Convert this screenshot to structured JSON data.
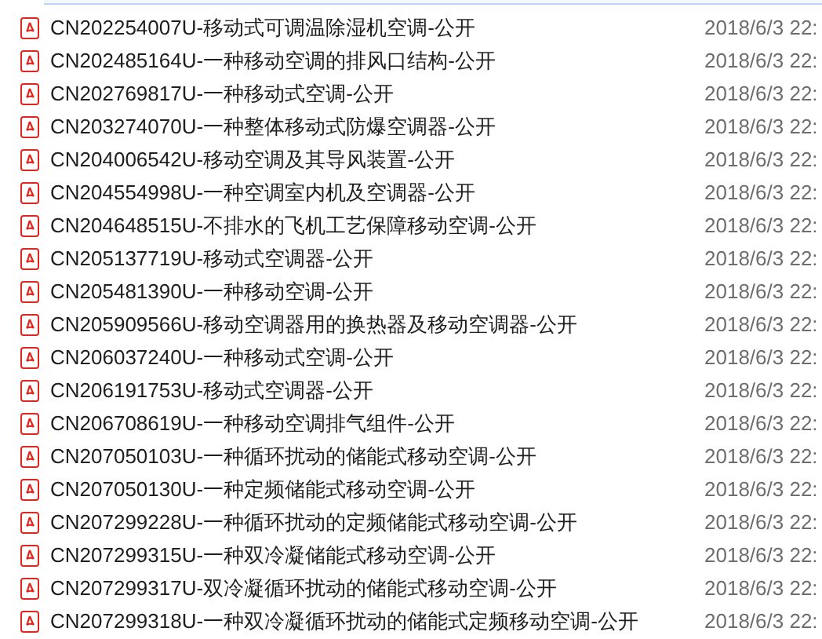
{
  "files": [
    {
      "name": "CN202254007U-移动式可调温除湿机空调-公开",
      "date": "2018/6/3 22:"
    },
    {
      "name": "CN202485164U-一种移动空调的排风口结构-公开",
      "date": "2018/6/3 22:"
    },
    {
      "name": "CN202769817U-一种移动式空调-公开",
      "date": "2018/6/3 22:"
    },
    {
      "name": "CN203274070U-一种整体移动式防爆空调器-公开",
      "date": "2018/6/3 22:"
    },
    {
      "name": "CN204006542U-移动空调及其导风装置-公开",
      "date": "2018/6/3 22:"
    },
    {
      "name": "CN204554998U-一种空调室内机及空调器-公开",
      "date": "2018/6/3 22:"
    },
    {
      "name": "CN204648515U-不排水的飞机工艺保障移动空调-公开",
      "date": "2018/6/3 22:"
    },
    {
      "name": "CN205137719U-移动式空调器-公开",
      "date": "2018/6/3 22:"
    },
    {
      "name": "CN205481390U-一种移动空调-公开",
      "date": "2018/6/3 22:"
    },
    {
      "name": "CN205909566U-移动空调器用的换热器及移动空调器-公开",
      "date": "2018/6/3 22:"
    },
    {
      "name": "CN206037240U-一种移动式空调-公开",
      "date": "2018/6/3 22:"
    },
    {
      "name": "CN206191753U-移动式空调器-公开",
      "date": "2018/6/3 22:"
    },
    {
      "name": "CN206708619U-一种移动空调排气组件-公开",
      "date": "2018/6/3 22:"
    },
    {
      "name": "CN207050103U-一种循环扰动的储能式移动空调-公开",
      "date": "2018/6/3 22:"
    },
    {
      "name": "CN207050130U-一种定频储能式移动空调-公开",
      "date": "2018/6/3 22:"
    },
    {
      "name": "CN207299228U-一种循环扰动的定频储能式移动空调-公开",
      "date": "2018/6/3 22:"
    },
    {
      "name": "CN207299315U-一种双冷凝储能式移动空调-公开",
      "date": "2018/6/3 22:"
    },
    {
      "name": "CN207299317U-双冷凝循环扰动的储能式移动空调-公开",
      "date": "2018/6/3 22:"
    },
    {
      "name": "CN207299318U-一种双冷凝循环扰动的储能式定频移动空调-公开",
      "date": "2018/6/3 22:"
    }
  ]
}
